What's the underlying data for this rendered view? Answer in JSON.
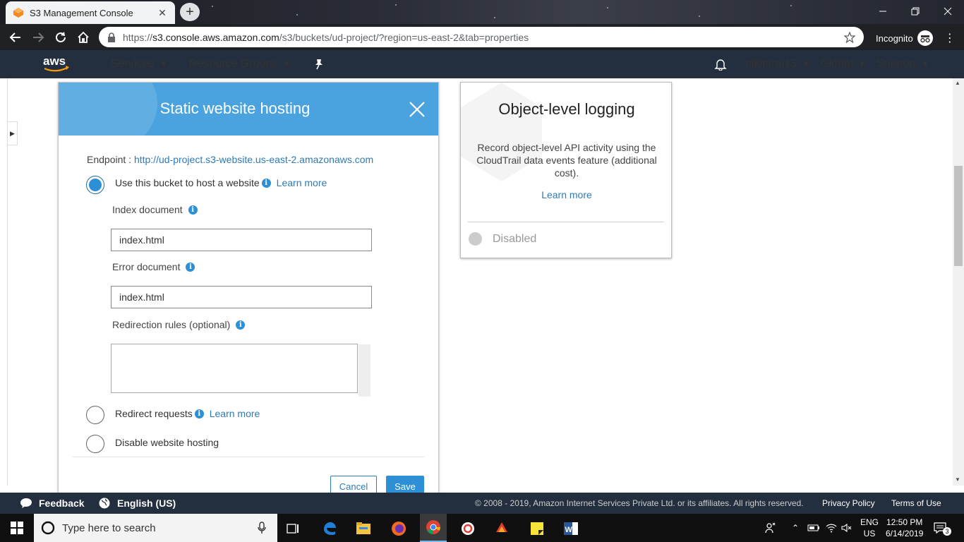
{
  "browser": {
    "tab_title": "S3 Management Console",
    "url_prefix": "https://",
    "url_host": "s3.console.aws.amazon.com",
    "url_path": "/s3/buckets/ud-project/?region=us-east-2&tab=properties",
    "incognito_label": "Incognito"
  },
  "aws_nav": {
    "services": "Services",
    "resource_groups": "Resource Groups",
    "user": "nikitarai15",
    "region": "Global",
    "support": "Support"
  },
  "static_hosting": {
    "title": "Static website hosting",
    "endpoint_label": "Endpoint : ",
    "endpoint_url": "http://ud-project.s3-website.us-east-2.amazonaws.com",
    "option_host": "Use this bucket to host a website",
    "learn_more": "Learn more",
    "index_label": "Index document",
    "index_value": "index.html",
    "error_label": "Error document",
    "error_value": "index.html",
    "redirect_rules_label": "Redirection rules (optional)",
    "redirect_rules_value": "",
    "option_redirect": "Redirect requests",
    "option_disable": "Disable website hosting",
    "cancel": "Cancel",
    "save": "Save",
    "selected_option": "host"
  },
  "object_logging": {
    "title": "Object-level logging",
    "description": "Record object-level API activity using the CloudTrail data events feature (additional cost).",
    "learn_more": "Learn more",
    "status": "Disabled"
  },
  "footer": {
    "feedback": "Feedback",
    "language": "English (US)",
    "copyright": "© 2008 - 2019, Amazon Internet Services Private Ltd. or its affiliates. All rights reserved.",
    "privacy": "Privacy Policy",
    "terms": "Terms of Use"
  },
  "taskbar": {
    "search_placeholder": "Type here to search",
    "lang_top": "ENG",
    "lang_bottom": "US",
    "time": "12:50 PM",
    "date": "6/14/2019",
    "notification_count": "3"
  },
  "colors": {
    "aws_nav": "#232f3e",
    "header_blue": "#4aa3df",
    "link": "#2f7ab5",
    "accent": "#2d8fd6"
  }
}
